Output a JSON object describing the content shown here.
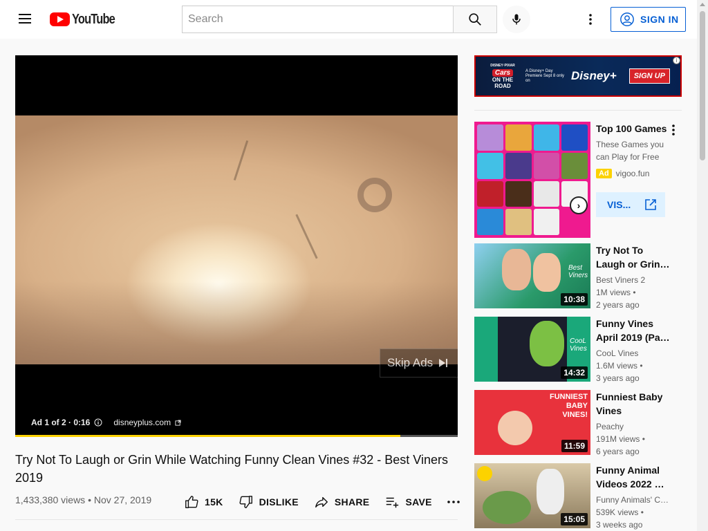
{
  "header": {
    "logo_text": "YouTube",
    "search_placeholder": "Search",
    "sign_in_label": "SIGN IN"
  },
  "player": {
    "skip_label": "Skip Ads",
    "ad_counter": "Ad 1 of 2 · 0:16",
    "ad_domain": "disneyplus.com",
    "ad_progress": 0.87
  },
  "video": {
    "title": "Try Not To Laugh or Grin While Watching Funny Clean Vines #32 - Best Viners 2019",
    "views": "1,433,380 views",
    "date": "Nov 27, 2019",
    "likes": "15K",
    "dislike_label": "DISLIKE",
    "share_label": "SHARE",
    "save_label": "SAVE"
  },
  "banner_ad": {
    "brand_top": "DISNEY·PIXAR",
    "cars_label": "Cars",
    "on_the_road": "ON THE ROAD",
    "premiere_text": "A Disney+ Day Premiere Sept 8 only on",
    "disney_plus": "Disney+",
    "signup_label": "SIGN UP"
  },
  "sidebar_ad": {
    "title": "Top 100 Games",
    "description": "These Games you can Play for Free",
    "badge": "Ad",
    "source": "vigoo.fun",
    "visit_label": "VIS..."
  },
  "recommendations": [
    {
      "title": "Try Not To Laugh or Grin…",
      "channel": "Best Viners 2",
      "views": "1M views •",
      "age": "2 years ago",
      "duration": "10:38",
      "thumb_text": "Best Viners"
    },
    {
      "title": "Funny Vines April 2019 (Pa…",
      "channel": "CooL Vines",
      "views": "1.6M views •",
      "age": "3 years ago",
      "duration": "14:32",
      "thumb_text": "CooL Vines"
    },
    {
      "title": "Funniest Baby Vines",
      "channel": "Peachy",
      "views": "191M views •",
      "age": "6 years ago",
      "duration": "11:59",
      "thumb_text": "FUNNIEST BABY VINES!"
    },
    {
      "title": "Funny Animal Videos 2022 …",
      "channel": "Funny Animals' C…",
      "views": "539K views •",
      "age": "3 weeks ago",
      "duration": "15:05",
      "thumb_text": ""
    }
  ],
  "colors": {
    "accent": "#065fd4",
    "brand_red": "#ff0000",
    "ad_yellow": "#fcd200"
  }
}
